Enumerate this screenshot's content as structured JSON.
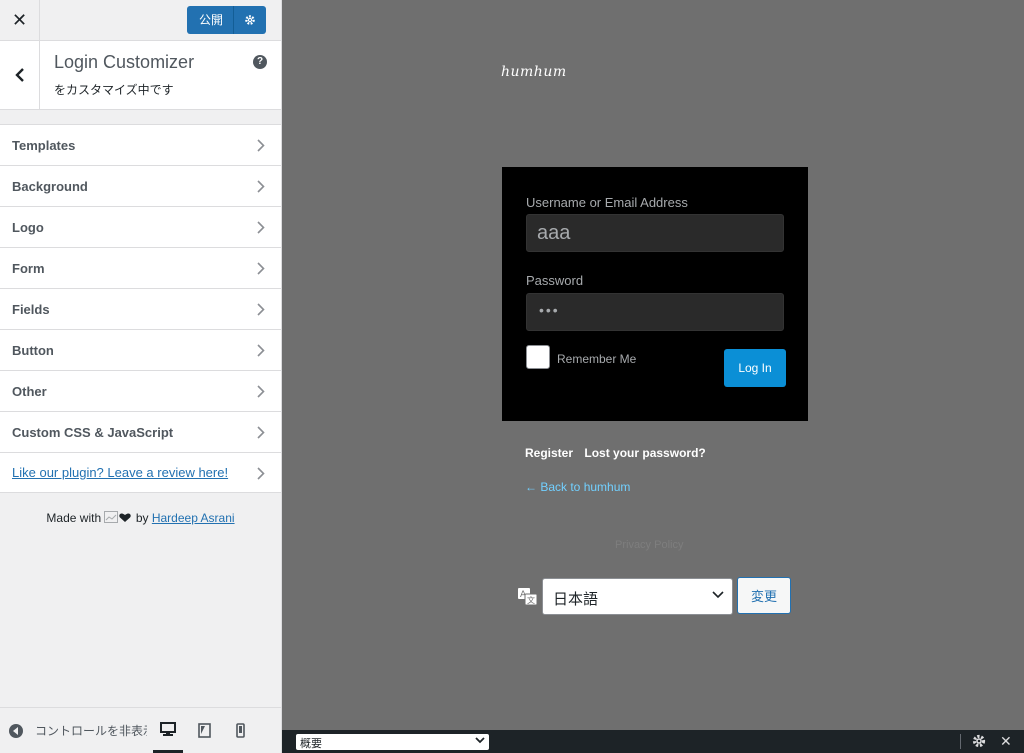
{
  "sidebar": {
    "close_icon": "✕",
    "publish_label": "公開",
    "panel": {
      "title": "Login Customizer",
      "subtitle": "をカスタマイズ中です",
      "help_icon": "?"
    },
    "menu": [
      {
        "label": "Templates"
      },
      {
        "label": "Background"
      },
      {
        "label": "Logo"
      },
      {
        "label": "Form"
      },
      {
        "label": "Fields"
      },
      {
        "label": "Button"
      },
      {
        "label": "Other"
      },
      {
        "label": "Custom CSS & JavaScript"
      },
      {
        "label": "Like our plugin? Leave a review here!"
      }
    ],
    "made_with": {
      "prefix": "Made with",
      "by": "by",
      "author": "Hardeep Asrani"
    },
    "footer": {
      "collapse_label": "コントロールを非表示"
    }
  },
  "preview": {
    "brand": "humhum",
    "username_label": "Username or Email Address",
    "username_value": "aaa",
    "password_label": "Password",
    "password_dots": "•••",
    "remember_label": "Remember Me",
    "login_button": "Log In",
    "register_link": "Register",
    "lost_password_link": "Lost your password?",
    "back_link": "← Back to humhum",
    "privacy": "Privacy Policy",
    "language_value": "日本語",
    "change_button": "変更"
  },
  "bottombar": {
    "select_value": "概要"
  },
  "colors": {
    "accent": "#2271b1",
    "login_button": "#0b8fd6",
    "preview_bg": "#6f6f6f",
    "login_box_bg": "#000000",
    "bottombar_bg": "#1d2327"
  }
}
